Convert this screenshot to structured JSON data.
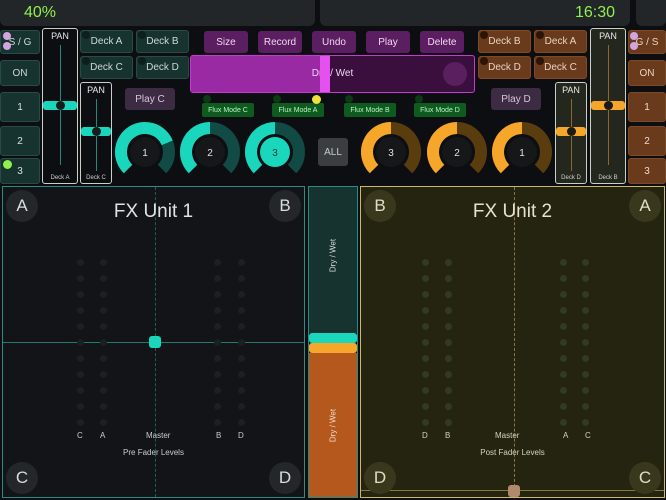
{
  "status": {
    "battery": "40%",
    "time": "16:30"
  },
  "left": {
    "sg_label": "S / G",
    "on_label": "ON",
    "num_buttons": [
      "1",
      "2",
      "3"
    ],
    "pan_a": {
      "title": "PAN",
      "deck": "Deck A",
      "value": 0.5
    },
    "pan_c": {
      "title": "PAN",
      "deck": "Deck C",
      "value": 0.5
    },
    "deck_buttons": [
      "Deck A",
      "Deck B",
      "Deck C",
      "Deck D"
    ],
    "play_button": "Play C"
  },
  "right": {
    "sg_label": "G / S",
    "on_label": "ON",
    "num_buttons": [
      "1",
      "2",
      "3"
    ],
    "pan_d": {
      "title": "PAN",
      "deck": "Deck D",
      "value": 0.5
    },
    "pan_b": {
      "title": "PAN",
      "deck": "Deck B",
      "value": 0.5
    },
    "deck_buttons": [
      "Deck B",
      "Deck A",
      "Deck D",
      "Deck C"
    ],
    "play_button": "Play D"
  },
  "top_buttons": [
    "Size",
    "Record",
    "Undo",
    "Play",
    "Delete"
  ],
  "drywet_top": {
    "label": "Dry / Wet",
    "value": 0.5
  },
  "flux_buttons": [
    "Flux Mode C",
    "Flux Mode A",
    "Flux Mode B",
    "Flux Mode D"
  ],
  "knobs_left": [
    {
      "label": "1",
      "value": 0.75
    },
    {
      "label": "2",
      "value": 0.5
    },
    {
      "label": "3",
      "value": 0.5
    }
  ],
  "knobs_right": [
    {
      "label": "3",
      "value": 0.5
    },
    {
      "label": "2",
      "value": 0.5
    },
    {
      "label": "1",
      "value": 0.5
    }
  ],
  "all_button": "ALL",
  "fx1": {
    "title": "FX Unit 1",
    "corners": {
      "tl": "A",
      "tr": "B",
      "bl": "C",
      "br": "D"
    },
    "level_labels": [
      "C",
      "A",
      "Master",
      "B",
      "D"
    ],
    "caption": "Pre Fader Levels"
  },
  "fx2": {
    "title": "FX Unit 2",
    "corners": {
      "tl": "B",
      "tr": "A",
      "bl": "D",
      "br": "C"
    },
    "level_labels": [
      "D",
      "B",
      "Master",
      "A",
      "C"
    ],
    "caption": "Post Fader Levels"
  },
  "center_fader": {
    "top_label": "Dry / Wet",
    "bottom_label": "Dry / Wet"
  },
  "colors": {
    "teal": "#19d6bd",
    "orange": "#f6a628",
    "purple": "#c53bd1",
    "green": "#8ff04e"
  }
}
